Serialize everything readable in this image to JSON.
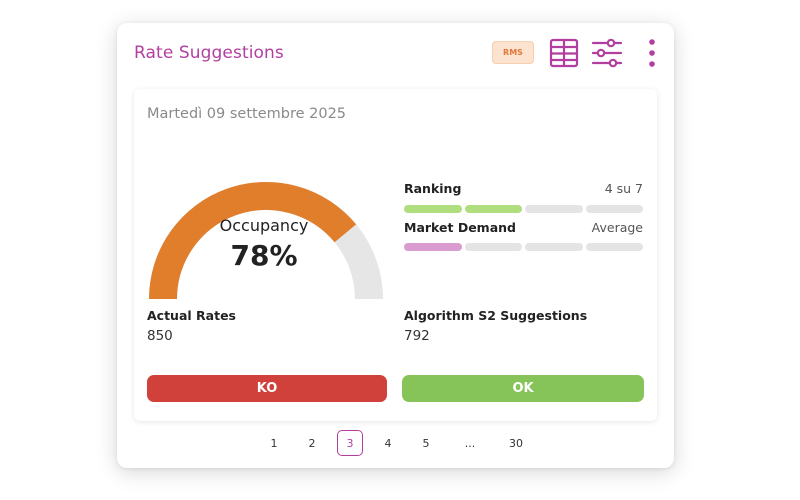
{
  "card": {
    "title": "Rate Suggestions",
    "rms_badge": "RMS",
    "icons": [
      "table-icon",
      "filter-sliders-icon",
      "more-vertical-icon"
    ]
  },
  "date": "Martedì 09 settembre 2025",
  "occupancy": {
    "label": "Occupancy",
    "value": "78%",
    "fraction": 0.78,
    "fill_color": "#e07e2c",
    "track_color": "#e6e6e6"
  },
  "ranking": {
    "label": "Ranking",
    "value": "4 su 7",
    "segments_total": 4,
    "segments_filled": 2,
    "color": "#b0dd7e"
  },
  "market_demand": {
    "label": "Market Demand",
    "value": "Average",
    "segments_total": 4,
    "segments_filled": 1,
    "color": "#d99bd0"
  },
  "actual_rates": {
    "label": "Actual Rates",
    "value": "850"
  },
  "suggestions": {
    "label": "Algorithm S2 Suggestions",
    "value": "792"
  },
  "buttons": {
    "ko": "KO",
    "ok": "OK"
  },
  "pagination": {
    "pages": [
      "1",
      "2",
      "3",
      "4",
      "5",
      "...",
      "30"
    ],
    "current": "3"
  },
  "colors": {
    "accent": "#b23fa0",
    "ko": "#d0413b",
    "ok": "#86c45a",
    "rms_badge_text": "#e07a3a"
  }
}
